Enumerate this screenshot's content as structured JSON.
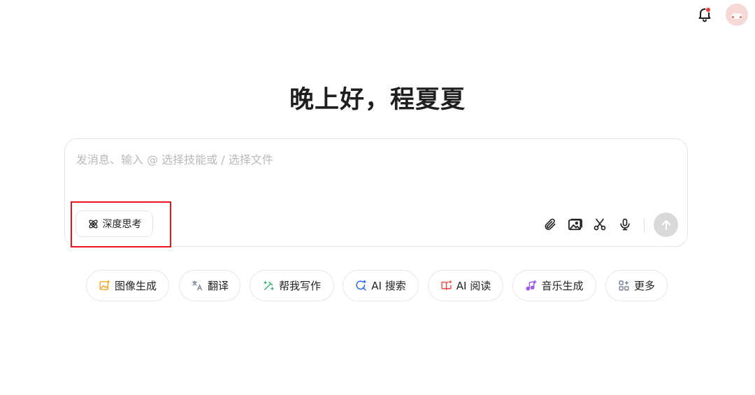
{
  "greeting": "晚上好，程夏夏",
  "composer": {
    "placeholder": "发消息、输入 @ 选择技能或 / 选择文件",
    "deep_think_label": "深度思考"
  },
  "toolbar": {
    "icons": [
      "paperclip-icon",
      "image-upload-icon",
      "scissors-icon",
      "microphone-icon",
      "send-arrow-icon"
    ]
  },
  "chips": [
    {
      "label": "图像生成",
      "icon": "image-gen-icon",
      "color": "#f5a623"
    },
    {
      "label": "翻译",
      "icon": "translate-icon",
      "color": "#7a8194"
    },
    {
      "label": "帮我写作",
      "icon": "pen-sparkle-icon",
      "color": "#2fb36b"
    },
    {
      "label": "AI 搜索",
      "icon": "search-icon",
      "color": "#2f6bf0"
    },
    {
      "label": "AI 阅读",
      "icon": "book-icon",
      "color": "#f24a4a"
    },
    {
      "label": "音乐生成",
      "icon": "music-icon",
      "color": "#9b5cf0"
    },
    {
      "label": "更多",
      "icon": "grid-icon",
      "color": "#7a8194"
    }
  ],
  "colors": {
    "highlight": "#e8161c",
    "notification_dot": "#f23a3a"
  }
}
